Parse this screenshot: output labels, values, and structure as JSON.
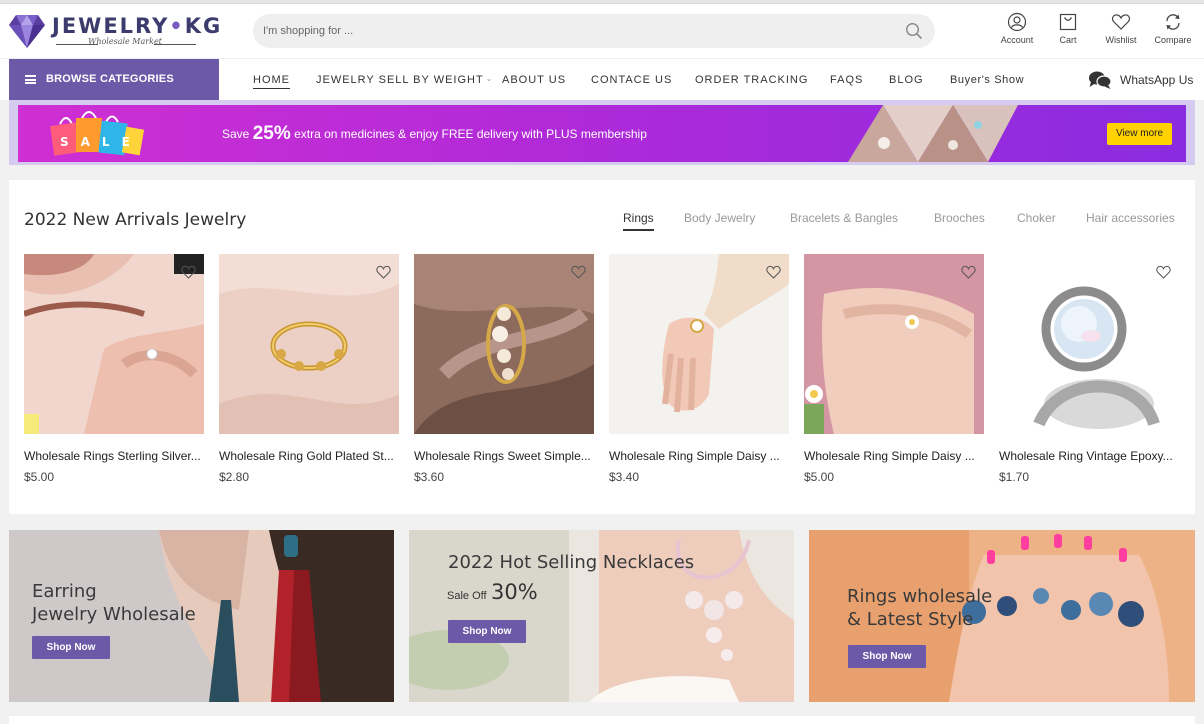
{
  "logo": {
    "brand_a": "JEWELRY",
    "brand_dot": "•",
    "brand_b": "KG",
    "tagline": "Wholesale Market"
  },
  "search": {
    "placeholder": "I'm shopping for ..."
  },
  "header_icons": [
    {
      "icon": "account-icon",
      "label": "Account"
    },
    {
      "icon": "cart-icon",
      "label": "Cart"
    },
    {
      "icon": "wishlist-heart-icon",
      "label": "Wishlist"
    },
    {
      "icon": "compare-icon",
      "label": "Compare"
    }
  ],
  "nav": {
    "browse": "BROWSE CATEGORIES",
    "links": [
      "HOME",
      "JEWELRY SELL BY WEIGHT",
      "ABOUT US",
      "CONTACE US",
      "ORDER TRACKING",
      "FAQS",
      "BLOG",
      "Buyer's Show"
    ],
    "whatsapp": "WhatsApp Us"
  },
  "promo": {
    "bags_text": "SALE",
    "pre": "Save",
    "big": "25%",
    "post": "extra on medicines & enjoy FREE delivery with PLUS membership",
    "button": "View more"
  },
  "arrivals": {
    "title": "2022 New Arrivals Jewelry",
    "tabs": [
      "Rings",
      "Body Jewelry",
      "Bracelets & Bangles",
      "Brooches",
      "Choker",
      "Hair accessories"
    ],
    "active_tab": "Rings",
    "products": [
      {
        "name": "Wholesale Rings Sterling Silver...",
        "price": "$5.00"
      },
      {
        "name": "Wholesale Ring Gold Plated St...",
        "price": "$2.80"
      },
      {
        "name": "Wholesale Rings Sweet Simple...",
        "price": "$3.60"
      },
      {
        "name": "Wholesale Ring Simple Daisy ...",
        "price": "$3.40"
      },
      {
        "name": "Wholesale Ring Simple Daisy ...",
        "price": "$5.00"
      },
      {
        "name": "Wholesale Ring Vintage Epoxy...",
        "price": "$1.70"
      }
    ]
  },
  "banners": [
    {
      "line1": "Earring",
      "line2": "Jewelry Wholesale",
      "button": "Shop Now"
    },
    {
      "line1": "2022 Hot Selling Necklaces",
      "sale_off": "Sale Off",
      "percent": "30%",
      "button": "Shop Now"
    },
    {
      "line1": "Rings wholesale",
      "line2": "& Latest Style",
      "button": "Shop Now"
    }
  ],
  "colors": {
    "accent": "#6c5aa9",
    "promo_start": "#cf2fd3",
    "promo_end": "#8a2be0",
    "view_more": "#ffd200"
  }
}
